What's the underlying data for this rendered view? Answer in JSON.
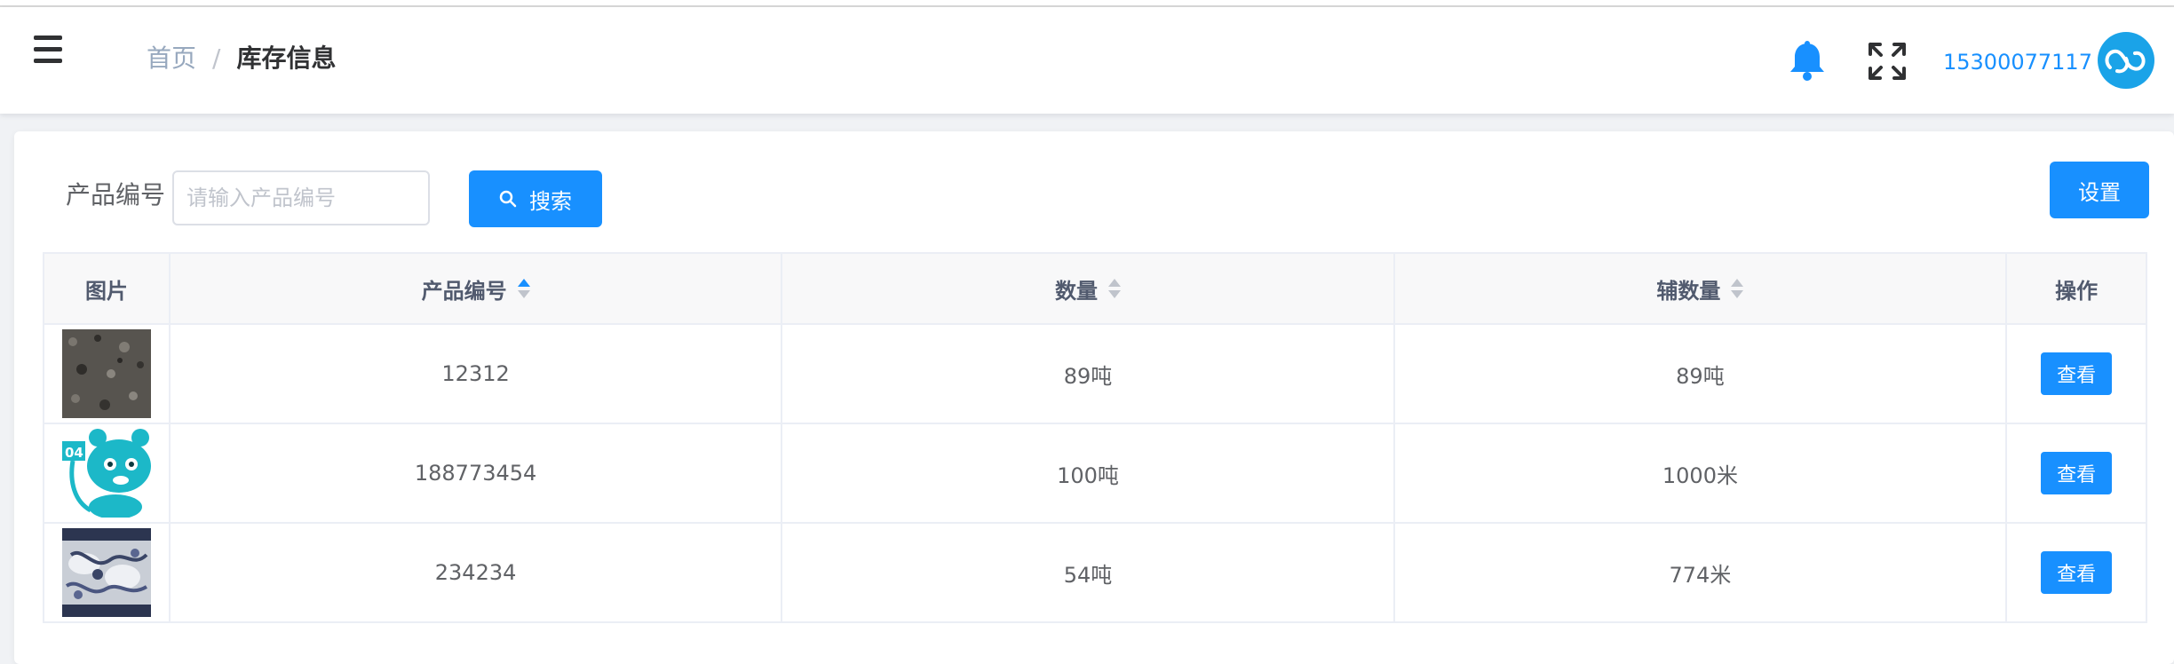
{
  "navbar": {
    "breadcrumb": {
      "home": "首页",
      "separator": "/",
      "current": "库存信息"
    },
    "user": {
      "phone": "15300077117"
    },
    "icons": [
      "menu-icon",
      "bell-icon",
      "fullscreen-icon"
    ],
    "accent_color": "#1890ff"
  },
  "search": {
    "label": "产品编号",
    "placeholder": "请输入产品编号",
    "value": "",
    "button_label": "搜索"
  },
  "toolbar": {
    "settings_label": "设置"
  },
  "table": {
    "columns": [
      "图片",
      "产品编号",
      "数量",
      "辅数量",
      "操作"
    ],
    "sort": {
      "产品编号": "ascending"
    },
    "rows": [
      {
        "image": "grey-textured-fabric",
        "code": "12312",
        "quantity": "89吨",
        "aux_quantity": "89吨",
        "action": "查看"
      },
      {
        "image": "teal-cartoon-bear",
        "code": "188773454",
        "quantity": "100吨",
        "aux_quantity": "1000米",
        "action": "查看"
      },
      {
        "image": "blue-white-floral-fabric",
        "code": "234234",
        "quantity": "54吨",
        "aux_quantity": "774米",
        "action": "查看"
      }
    ]
  }
}
